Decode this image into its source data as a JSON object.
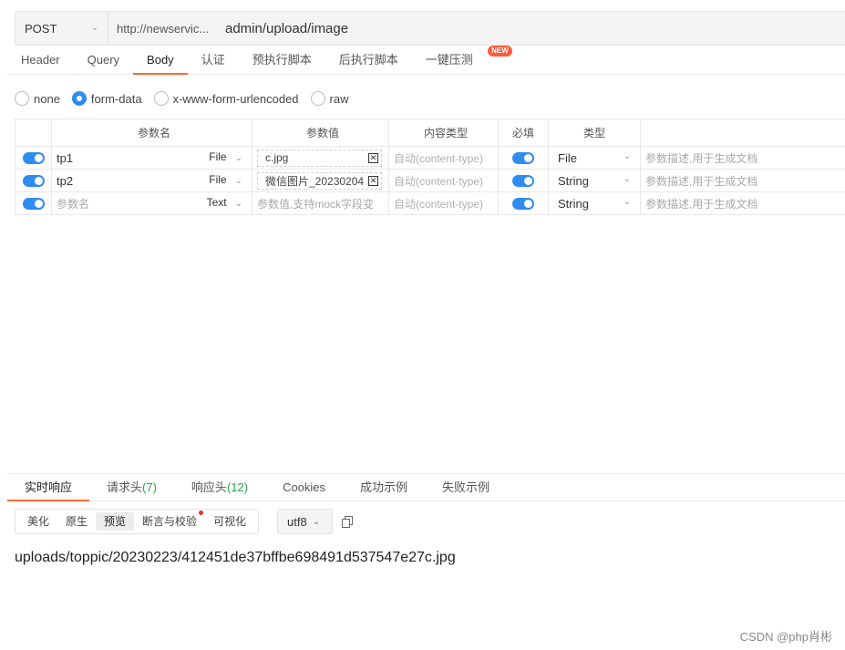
{
  "request": {
    "method": "POST",
    "url_base": "http://newservic...",
    "url_path": "admin/upload/image"
  },
  "tabs": [
    {
      "label": "Header"
    },
    {
      "label": "Query"
    },
    {
      "label": "Body"
    },
    {
      "label": "认证"
    },
    {
      "label": "预执行脚本"
    },
    {
      "label": "后执行脚本"
    },
    {
      "label": "一键压测",
      "badge": "NEW"
    }
  ],
  "body_types": [
    {
      "label": "none",
      "selected": false
    },
    {
      "label": "form-data",
      "selected": true
    },
    {
      "label": "x-www-form-urlencoded",
      "selected": false
    },
    {
      "label": "raw",
      "selected": false
    }
  ],
  "table": {
    "headers": [
      "参数名",
      "参数值",
      "内容类型",
      "必填",
      "类型"
    ],
    "rows": [
      {
        "name": "tp1",
        "field_type": "File",
        "value": "c.jpg",
        "content_type": "自动(content-type)",
        "param_type": "File",
        "desc": "参数描述,用于生成文档"
      },
      {
        "name": "tp2",
        "field_type": "File",
        "value": "微信图片_20230204",
        "content_type": "自动(content-type)",
        "param_type": "String",
        "desc": "参数描述,用于生成文档"
      },
      {
        "name_placeholder": "参数名",
        "field_type": "Text",
        "value_placeholder": "参数值,支持mock字段变",
        "content_type": "自动(content-type)",
        "param_type": "String",
        "desc": "参数描述,用于生成文档"
      }
    ]
  },
  "response_tabs": [
    {
      "label": "实时响应"
    },
    {
      "label": "请求头",
      "count": "(7)"
    },
    {
      "label": "响应头",
      "count": "(12)"
    },
    {
      "label": "Cookies"
    },
    {
      "label": "成功示例"
    },
    {
      "label": "失败示例"
    }
  ],
  "view_modes": [
    "美化",
    "原生",
    "预览",
    "断言与校验",
    "可视化"
  ],
  "encoding": "utf8",
  "result": "uploads/toppic/20230223/412451de37bffbe698491d537547e27c.jpg",
  "watermark": "CSDN @php肖彬",
  "colors": {
    "accent": "#ff6a2f",
    "toggle": "#2f8cf0",
    "count": "#2ba24c"
  }
}
